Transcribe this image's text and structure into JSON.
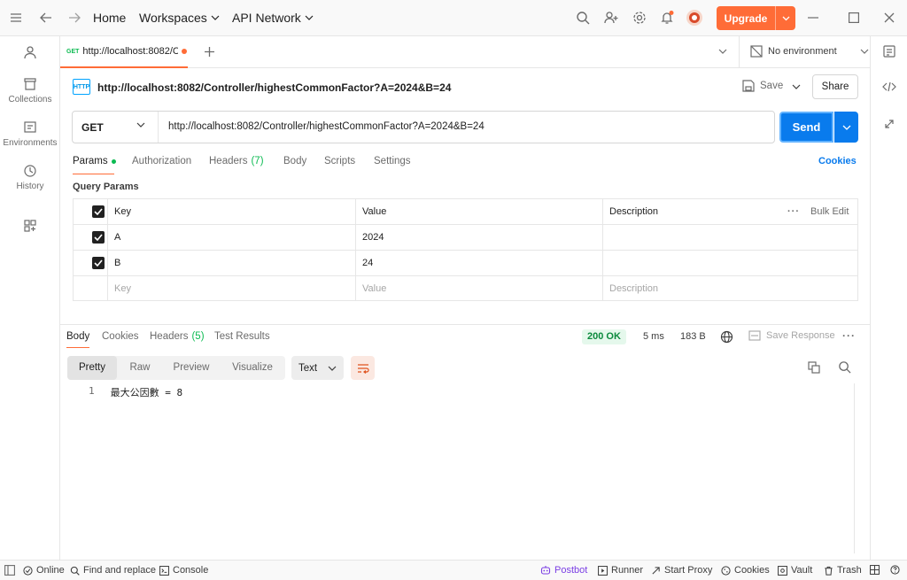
{
  "titlebar": {
    "home": "Home",
    "workspaces": "Workspaces",
    "api_network": "API Network",
    "upgrade": "Upgrade"
  },
  "sidebar": {
    "items": [
      {
        "label": "Collections",
        "icon": "collections-icon"
      },
      {
        "label": "Environments",
        "icon": "environments-icon"
      },
      {
        "label": "History",
        "icon": "history-icon"
      }
    ]
  },
  "tabs": {
    "active": {
      "method": "GET",
      "title": "http://localhost:8082/Co"
    },
    "environment": "No environment"
  },
  "request": {
    "title": "http://localhost:8082/Controller/highestCommonFactor?A=2024&B=24",
    "save": "Save",
    "share": "Share",
    "method": "GET",
    "url": "http://localhost:8082/Controller/highestCommonFactor?A=2024&B=24",
    "send": "Send",
    "tabs": {
      "params": "Params",
      "authorization": "Authorization",
      "headers": "Headers",
      "headers_count": "(7)",
      "body": "Body",
      "scripts": "Scripts",
      "settings": "Settings",
      "cookies": "Cookies"
    },
    "query_params_label": "Query Params",
    "table": {
      "headers": {
        "key": "Key",
        "value": "Value",
        "description": "Description",
        "bulk_edit": "Bulk Edit"
      },
      "rows": [
        {
          "key": "A",
          "value": "2024",
          "description": ""
        },
        {
          "key": "B",
          "value": "24",
          "description": ""
        }
      ],
      "placeholders": {
        "key": "Key",
        "value": "Value",
        "description": "Description"
      }
    }
  },
  "response": {
    "tabs": {
      "body": "Body",
      "cookies": "Cookies",
      "headers": "Headers",
      "headers_count": "(5)",
      "test_results": "Test Results"
    },
    "status": "200 OK",
    "time": "5 ms",
    "size": "183 B",
    "save_response": "Save Response",
    "formats": [
      "Pretty",
      "Raw",
      "Preview",
      "Visualize"
    ],
    "type": "Text",
    "code": {
      "line": "1",
      "text": "最大公因數 = 8"
    }
  },
  "statusbar": {
    "online": "Online",
    "find_replace": "Find and replace",
    "console": "Console",
    "postbot": "Postbot",
    "runner": "Runner",
    "start_proxy": "Start Proxy",
    "cookies": "Cookies",
    "vault": "Vault",
    "trash": "Trash"
  },
  "colors": {
    "accent": "#ff6c37",
    "send": "#097bed",
    "get": "#0cbb52",
    "ok": "#0a8a3c"
  }
}
